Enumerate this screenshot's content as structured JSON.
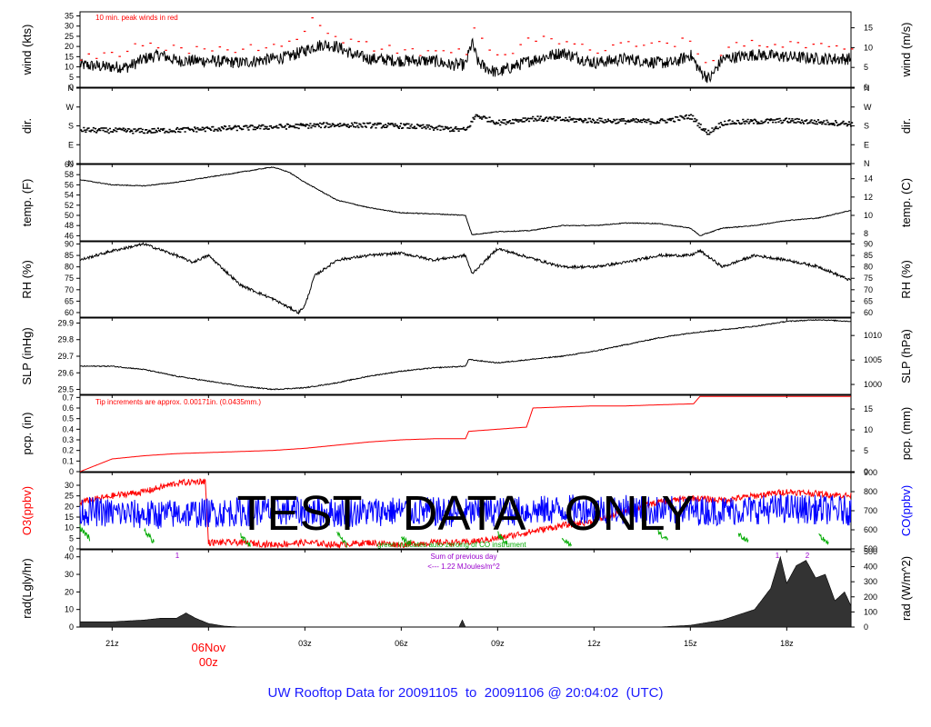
{
  "title": "UW Rooftop Data for 20091105  to  20091106 @ 20:04:02  (UTC)",
  "watermark": "TEST   DATA   ONLY",
  "colors": {
    "black": "#000000",
    "red": "#ff0000",
    "blue": "#0000ff",
    "green": "#00aa00",
    "purple": "#9900cc",
    "title": "#1a1aff"
  },
  "time_axis": {
    "start_hour": 20,
    "end_hour": 44,
    "ticks": [
      {
        "hour": 21,
        "label": "21z"
      },
      {
        "hour": 24,
        "label": ""
      },
      {
        "hour": 27,
        "label": "03z"
      },
      {
        "hour": 30,
        "label": "06z"
      },
      {
        "hour": 33,
        "label": "09z"
      },
      {
        "hour": 36,
        "label": "12z"
      },
      {
        "hour": 39,
        "label": "15z"
      },
      {
        "hour": 42,
        "label": "18z"
      }
    ],
    "day_marker": {
      "hour": 24,
      "line1": "06Nov",
      "line2": "00z"
    }
  },
  "chart_data": [
    {
      "id": "wind",
      "type": "line",
      "left_label": "wind (kts)",
      "right_label": "wind (m/s)",
      "ylim": [
        0,
        37
      ],
      "left_ticks": [
        "0",
        "5",
        "10",
        "15",
        "20",
        "25",
        "30",
        "35"
      ],
      "left_values": [
        0,
        5,
        10,
        15,
        20,
        25,
        30,
        35
      ],
      "right_ticks": [
        "0",
        "5",
        "10",
        "15"
      ],
      "right_values": [
        0,
        9.72,
        19.44,
        29.16
      ],
      "annotation": "10 min. peak winds in red",
      "series": [
        {
          "name": "wind",
          "color": "black",
          "noise": 3,
          "x": [
            20,
            20.8,
            21.5,
            22,
            22.5,
            23,
            24,
            25,
            26,
            26.5,
            27,
            27.3,
            27.6,
            28,
            28.5,
            29,
            30,
            31,
            31.5,
            32,
            32.2,
            32.4,
            32.7,
            33,
            33.3,
            34,
            35,
            36,
            37,
            38,
            38.5,
            39,
            39.3,
            39.6,
            40,
            41,
            42,
            43,
            44
          ],
          "y": [
            11,
            10,
            10,
            14,
            16,
            13,
            13,
            12,
            14,
            15,
            18,
            20,
            21,
            20,
            16,
            14,
            13,
            13,
            11,
            11,
            22,
            12,
            9,
            7,
            9,
            13,
            17,
            12,
            14,
            12,
            12,
            16,
            8,
            4,
            14,
            16,
            15,
            14,
            14
          ]
        },
        {
          "name": "10 min. peak winds",
          "color": "red",
          "style": "dash",
          "noise": 2,
          "x": [
            20,
            21,
            22,
            23,
            24,
            25,
            26,
            27,
            27.2,
            28,
            29,
            30,
            31,
            32,
            32.2,
            33,
            34,
            35,
            36,
            37,
            38,
            39,
            39.5,
            40,
            41,
            42,
            43,
            44
          ],
          "y": [
            15,
            16,
            21,
            19,
            18,
            19,
            20,
            27,
            35,
            24,
            20,
            18,
            17,
            17,
            28,
            14,
            24,
            22,
            18,
            21,
            21,
            23,
            9,
            19,
            22,
            21,
            20,
            19
          ]
        }
      ]
    },
    {
      "id": "dir",
      "type": "scatter",
      "left_label": "dir.",
      "right_label": "dir.",
      "ylim": [
        0,
        360
      ],
      "left_ticks": [
        "N",
        "E",
        "S",
        "W",
        "N"
      ],
      "left_values": [
        0,
        90,
        180,
        270,
        360
      ],
      "right_ticks": [
        "N",
        "E",
        "S",
        "W",
        "N"
      ],
      "right_values": [
        0,
        90,
        180,
        270,
        360
      ],
      "series": [
        {
          "name": "direction",
          "color": "black",
          "noise": 12,
          "x": [
            20,
            22,
            24,
            26,
            28,
            30,
            32,
            32.3,
            33,
            34,
            36,
            38,
            39,
            39.5,
            40,
            42,
            44
          ],
          "y": [
            160,
            155,
            165,
            175,
            185,
            180,
            160,
            230,
            195,
            215,
            205,
            200,
            225,
            145,
            195,
            205,
            190
          ]
        }
      ]
    },
    {
      "id": "temp",
      "type": "line",
      "left_label": "temp. (F)",
      "right_label": "temp. (C)",
      "ylim": [
        45,
        60
      ],
      "left_ticks": [
        "46",
        "48",
        "50",
        "52",
        "54",
        "56",
        "58",
        "60"
      ],
      "left_values": [
        46,
        48,
        50,
        52,
        54,
        56,
        58,
        60
      ],
      "right_ticks": [
        "8",
        "10",
        "12",
        "14"
      ],
      "right_values": [
        46.4,
        50,
        53.6,
        57.2
      ],
      "series": [
        {
          "name": "temperature",
          "color": "black",
          "noise": 0.08,
          "x": [
            20,
            21,
            22,
            23,
            24,
            25,
            26,
            26.5,
            27,
            28,
            29,
            30,
            31,
            32,
            32.2,
            33,
            34,
            35,
            36,
            37,
            38,
            39,
            39.3,
            40,
            41,
            42,
            43,
            44
          ],
          "y": [
            57,
            56,
            55.8,
            56.5,
            57.5,
            58.5,
            59.5,
            58.5,
            56.5,
            53,
            51.5,
            50.5,
            50.3,
            50,
            46.2,
            46.8,
            47,
            48,
            48,
            48.5,
            48.4,
            47.5,
            46,
            47.5,
            48,
            49,
            49.5,
            51
          ]
        }
      ]
    },
    {
      "id": "rh",
      "type": "line",
      "left_label": "RH (%)",
      "right_label": "RH (%)",
      "ylim": [
        58,
        91
      ],
      "left_ticks": [
        "60",
        "65",
        "70",
        "75",
        "80",
        "85",
        "90"
      ],
      "left_values": [
        60,
        65,
        70,
        75,
        80,
        85,
        90
      ],
      "right_ticks": [
        "60",
        "65",
        "70",
        "75",
        "80",
        "85",
        "90"
      ],
      "right_values": [
        60,
        65,
        70,
        75,
        80,
        85,
        90
      ],
      "series": [
        {
          "name": "relative humidity",
          "color": "black",
          "noise": 0.6,
          "x": [
            20,
            21,
            22,
            23,
            23.5,
            24,
            25,
            26,
            26.8,
            27,
            27.3,
            28,
            29,
            30,
            31,
            32,
            32.2,
            33,
            34,
            35,
            36,
            37,
            38,
            39,
            39.3,
            40,
            41,
            42,
            43,
            44
          ],
          "y": [
            83,
            87,
            90,
            85,
            82,
            85,
            72,
            66,
            60,
            63,
            76,
            83,
            85,
            86,
            83,
            85,
            77,
            88,
            84,
            80,
            80,
            82,
            85,
            85,
            87,
            80,
            85,
            83,
            80,
            74
          ]
        }
      ]
    },
    {
      "id": "slp",
      "type": "line",
      "left_label": "SLP (inHg)",
      "right_label": "SLP (hPa)",
      "ylim": [
        29.47,
        29.93
      ],
      "left_ticks": [
        "29.5",
        "29.6",
        "29.7",
        "29.8",
        "29.9"
      ],
      "left_values": [
        29.5,
        29.6,
        29.7,
        29.8,
        29.9
      ],
      "right_ticks": [
        "1000",
        "1005",
        "1010"
      ],
      "right_values": [
        29.53,
        29.677,
        29.825
      ],
      "series": [
        {
          "name": "sea level pressure",
          "color": "black",
          "noise": 0.003,
          "x": [
            20,
            21,
            22,
            23,
            24,
            25,
            26,
            27,
            28,
            29,
            30,
            31,
            32,
            32.1,
            33,
            34,
            35,
            36,
            37,
            38,
            39,
            40,
            41,
            42,
            43,
            44
          ],
          "y": [
            29.64,
            29.64,
            29.62,
            29.58,
            29.55,
            29.52,
            29.5,
            29.51,
            29.54,
            29.58,
            29.61,
            29.63,
            29.64,
            29.68,
            29.66,
            29.68,
            29.7,
            29.73,
            29.77,
            29.81,
            29.84,
            29.86,
            29.88,
            29.91,
            29.92,
            29.91
          ]
        }
      ]
    },
    {
      "id": "pcp",
      "type": "line",
      "left_label": "pcp. (in)",
      "right_label": "pcp. (mm)",
      "ylim": [
        0,
        0.72
      ],
      "left_ticks": [
        "0",
        "0.1",
        "0.2",
        "0.3",
        "0.4",
        "0.5",
        "0.6",
        "0.7"
      ],
      "left_values": [
        0,
        0.1,
        0.2,
        0.3,
        0.4,
        0.5,
        0.6,
        0.7
      ],
      "right_ticks": [
        "0",
        "5",
        "10",
        "15"
      ],
      "right_values": [
        0,
        0.197,
        0.394,
        0.591
      ],
      "annotation": "Tip increments are approx. 0.00171in. (0.0435mm.)",
      "series": [
        {
          "name": "precipitation",
          "color": "red",
          "noise": 0,
          "x": [
            20,
            21,
            22,
            23,
            24,
            25,
            26,
            27,
            28,
            29,
            30,
            31,
            32,
            32.1,
            33,
            33.9,
            34.1,
            35,
            36,
            37,
            38,
            39.1,
            39.3,
            40,
            41,
            42,
            43,
            44
          ],
          "y": [
            0,
            0.12,
            0.15,
            0.17,
            0.18,
            0.19,
            0.2,
            0.22,
            0.25,
            0.28,
            0.3,
            0.31,
            0.31,
            0.38,
            0.4,
            0.42,
            0.6,
            0.61,
            0.62,
            0.62,
            0.63,
            0.64,
            0.71,
            0.71,
            0.71,
            0.71,
            0.71,
            0.71
          ]
        }
      ]
    },
    {
      "id": "gas",
      "type": "line",
      "left_label": "O3(ppbv)",
      "right_label": "CO(ppbv)",
      "ylim": [
        0,
        36
      ],
      "left_ticks": [
        "0",
        "5",
        "10",
        "15",
        "20",
        "25",
        "30"
      ],
      "left_values": [
        0,
        5,
        10,
        15,
        20,
        25,
        30
      ],
      "right_ticks": [
        "500",
        "600",
        "700",
        "800",
        "900"
      ],
      "right_values": [
        0,
        9,
        18,
        27,
        36
      ],
      "annotation": "green indicates auto-zeroing of CO instrument",
      "series": [
        {
          "name": "O3",
          "color": "red",
          "noise": 1.5,
          "x": [
            20,
            21,
            22,
            23,
            23.9,
            24,
            25,
            26,
            27,
            28,
            29,
            30,
            31,
            32,
            33,
            34,
            35,
            36,
            37,
            38,
            39,
            40,
            41,
            42,
            43,
            44
          ],
          "y": [
            22,
            25,
            27,
            31,
            32,
            3,
            3,
            2,
            3,
            2,
            3,
            2,
            3,
            3,
            5,
            8,
            11,
            13,
            18,
            22,
            24,
            23,
            25,
            27,
            26,
            25
          ]
        },
        {
          "name": "CO",
          "color": "blue",
          "noise": 7,
          "x": [
            20,
            22,
            24,
            26,
            28,
            30,
            32,
            34,
            36,
            38,
            40,
            42,
            44
          ],
          "y": [
            18,
            16,
            17,
            18,
            17,
            18,
            17,
            18,
            19,
            18,
            18,
            19,
            18
          ]
        },
        {
          "name": "CO zeroing",
          "color": "green",
          "noise": 1.5,
          "x": [
            20,
            20.3,
            22,
            22.3,
            25,
            25.3,
            28,
            28.3,
            30,
            30.3,
            33,
            33.3,
            35,
            35.3,
            38,
            38.3,
            40.5,
            40.8,
            43,
            43.3
          ],
          "y": [
            10,
            5,
            9,
            3,
            6,
            2,
            8,
            2,
            5,
            3,
            7,
            3,
            4,
            2,
            8,
            4,
            7,
            3,
            6,
            3
          ]
        }
      ]
    },
    {
      "id": "rad",
      "type": "area",
      "left_label": "rad(Lgly/hr)",
      "right_label": "rad (W/m^2)",
      "ylim": [
        0,
        44
      ],
      "left_ticks": [
        "0",
        "10",
        "20",
        "30",
        "40"
      ],
      "left_values": [
        0,
        10,
        20,
        30,
        40
      ],
      "right_ticks": [
        "0",
        "100",
        "200",
        "300",
        "400",
        "500"
      ],
      "right_values": [
        0,
        8.6,
        17.2,
        25.8,
        34.4,
        43
      ],
      "annotations": {
        "sum_line1": "Sum of previous day",
        "sum_line2": "<--- 1.22 MJoules/m^2",
        "marker1": "1",
        "marker2": "1",
        "marker3": "2"
      },
      "series": [
        {
          "name": "radiation",
          "color": "black",
          "noise": 0,
          "x": [
            20,
            21,
            22,
            22.5,
            23,
            23.3,
            23.6,
            24,
            24.5,
            25,
            30,
            31.8,
            31.9,
            32,
            35,
            38,
            39,
            40,
            41,
            41.5,
            41.8,
            42,
            42.3,
            42.6,
            42.9,
            43.2,
            43.5,
            43.8,
            44
          ],
          "y": [
            3,
            3,
            4,
            5,
            5,
            8,
            5,
            2,
            0.5,
            0,
            0,
            0,
            4,
            0,
            0,
            0,
            1,
            4,
            10,
            22,
            40,
            25,
            35,
            38,
            28,
            30,
            15,
            20,
            12
          ]
        }
      ]
    }
  ]
}
